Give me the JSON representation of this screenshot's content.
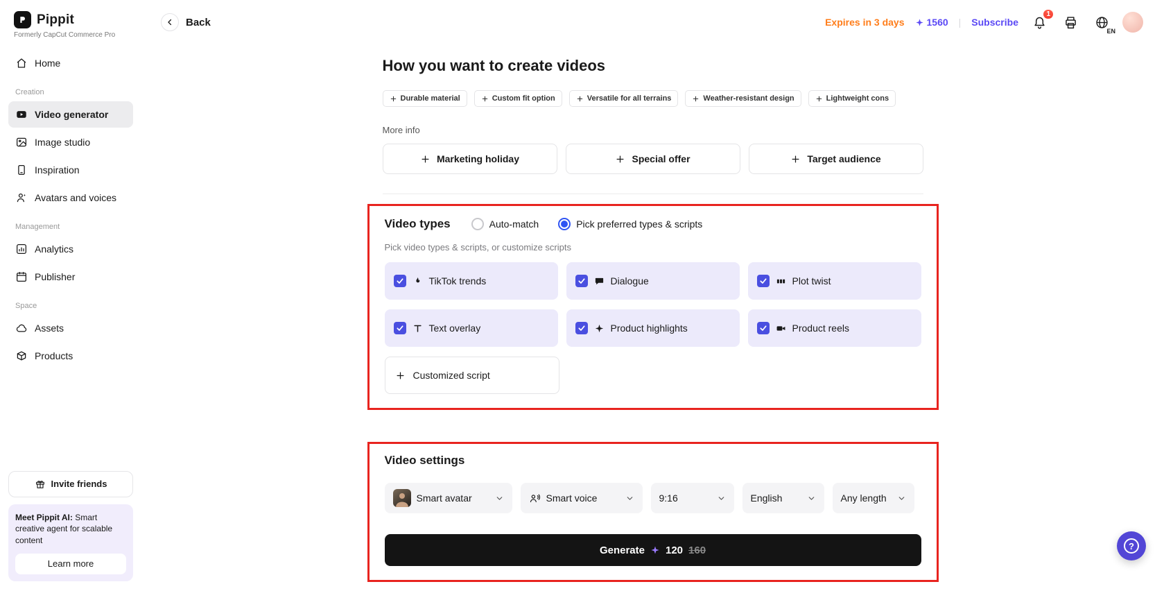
{
  "brand": {
    "name": "Pippit",
    "tagline": "Formerly CapCut Commerce Pro"
  },
  "topbar": {
    "back": "Back",
    "expires": "Expires in 3 days",
    "credits": "1560",
    "subscribe": "Subscribe",
    "notifications": "1",
    "language": "EN"
  },
  "sidebar": {
    "home": "Home",
    "sections": [
      {
        "label": "Creation",
        "items": [
          {
            "label": "Video generator",
            "active": true
          },
          {
            "label": "Image studio",
            "active": false
          },
          {
            "label": "Inspiration",
            "active": false
          },
          {
            "label": "Avatars and voices",
            "active": false
          }
        ]
      },
      {
        "label": "Management",
        "items": [
          {
            "label": "Analytics",
            "active": false
          },
          {
            "label": "Publisher",
            "active": false
          }
        ]
      },
      {
        "label": "Space",
        "items": [
          {
            "label": "Assets",
            "active": false
          },
          {
            "label": "Products",
            "active": false
          }
        ]
      }
    ],
    "invite_label": "Invite friends",
    "promo": {
      "lead": "Meet Pippit AI:",
      "text": " Smart creative agent for scalable content",
      "cta": "Learn more"
    }
  },
  "content": {
    "title": "How you want to create videos",
    "chips": [
      "Durable material",
      "Custom fit option",
      "Versatile for all terrains",
      "Weather-resistant design",
      "Lightweight cons"
    ],
    "more_info": "More info",
    "info_buttons": [
      "Marketing holiday",
      "Special offer",
      "Target audience"
    ],
    "video_types": {
      "title": "Video types",
      "radios": [
        {
          "label": "Auto-match",
          "selected": false
        },
        {
          "label": "Pick preferred types & scripts",
          "selected": true
        }
      ],
      "helper": "Pick video types & scripts, or customize scripts",
      "options": [
        {
          "label": "TikTok trends",
          "icon": "fire-icon",
          "checked": true
        },
        {
          "label": "Dialogue",
          "icon": "speech-bubble-icon",
          "checked": true
        },
        {
          "label": "Plot twist",
          "icon": "film-frames-icon",
          "checked": true
        },
        {
          "label": "Text overlay",
          "icon": "text-icon",
          "checked": true
        },
        {
          "label": "Product highlights",
          "icon": "sparkle-icon",
          "checked": true
        },
        {
          "label": "Product reels",
          "icon": "video-camera-icon",
          "checked": true
        }
      ],
      "custom_script_label": "Customized script"
    },
    "video_settings": {
      "title": "Video settings",
      "dropdowns": [
        {
          "label": "Smart avatar",
          "icon": "avatar-thumbnail"
        },
        {
          "label": "Smart voice",
          "icon": "voice-icon"
        },
        {
          "label": "9:16"
        },
        {
          "label": "English"
        },
        {
          "label": "Any length"
        }
      ],
      "generate": {
        "label": "Generate",
        "cost": "120",
        "original_cost": "160"
      }
    }
  },
  "help": {
    "glyph": "?"
  },
  "colors": {
    "accent_purple": "#5a48f5",
    "radio_blue": "#2f54f3",
    "checkbox_indigo": "#4a4fe0",
    "card_purple": "#eceafb",
    "annotation_red": "#e8241f",
    "expires_orange": "#ff7d1a",
    "generate_black": "#141414",
    "help_fab": "#5246d6"
  }
}
